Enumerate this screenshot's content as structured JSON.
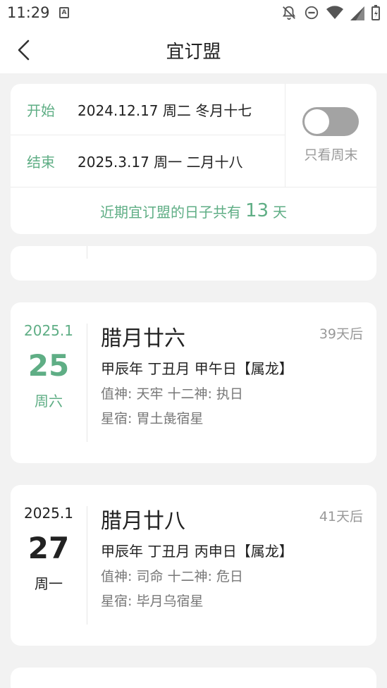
{
  "status_bar": {
    "time": "11:29",
    "app_icon_letter": "A"
  },
  "header": {
    "title": "宜订盟"
  },
  "range": {
    "start_label": "开始",
    "start_value": "2024.12.17 周二 冬月十七",
    "end_label": "结束",
    "end_value": "2025.3.17 周一 二月十八",
    "weekend_only_label": "只看周末",
    "weekend_only_enabled": false
  },
  "summary": {
    "prefix": "近期宜订盟的日子共有",
    "count": "13",
    "suffix": "天"
  },
  "days": [
    {
      "year_month": "2025.1",
      "day": "25",
      "weekday": "周六",
      "is_weekend": true,
      "lunar": "腊月廿六",
      "days_after": "39天后",
      "ganzhi": "甲辰年 丁丑月 甲午日【属龙】",
      "gods": "值神: 天牢  十二神: 执日",
      "star": "星宿: 胃土彘宿星"
    },
    {
      "year_month": "2025.1",
      "day": "27",
      "weekday": "周一",
      "is_weekend": false,
      "lunar": "腊月廿八",
      "days_after": "41天后",
      "ganzhi": "甲辰年 丁丑月 丙申日【属龙】",
      "gods": "值神: 司命  十二神: 危日",
      "star": "星宿: 毕月乌宿星"
    }
  ],
  "colors": {
    "accent": "#5fae85",
    "background": "#f2f2f2",
    "toggle_off": "#a3a3a3"
  }
}
